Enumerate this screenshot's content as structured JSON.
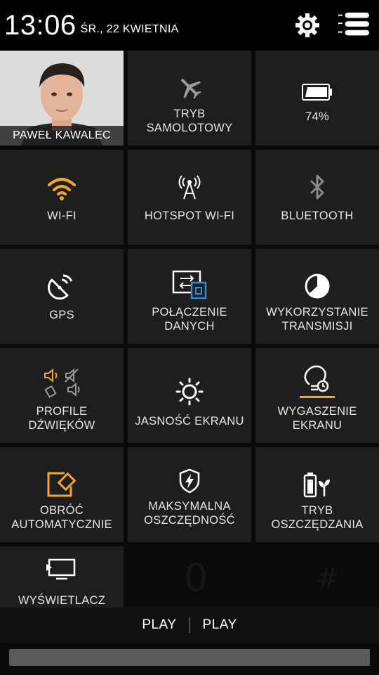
{
  "status_bar": {
    "time": "13:06",
    "date": "ŚR., 22 KWIETNIA"
  },
  "profile": {
    "name": "PAWEŁ KAWALEC"
  },
  "tiles": {
    "airplane": {
      "label": "TRYB SAMOLOTOWY",
      "icon": "airplane-icon"
    },
    "battery": {
      "label": "74%",
      "icon": "battery-icon",
      "level": 0.74
    },
    "wifi": {
      "label": "WI-FI",
      "icon": "wifi-icon",
      "active": true
    },
    "hotspot": {
      "label": "HOTSPOT WI-FI",
      "icon": "hotspot-icon"
    },
    "bluetooth": {
      "label": "BLUETOOTH",
      "icon": "bluetooth-icon"
    },
    "gps": {
      "label": "GPS",
      "icon": "gps-icon"
    },
    "data": {
      "label": "POŁĄCZENIE DANYCH",
      "icon": "data-connection-icon"
    },
    "usage": {
      "label": "WYKORZYSTANIE TRANSMISJI",
      "icon": "data-usage-icon"
    },
    "sound": {
      "label": "PROFILE DŹWIĘKÓW",
      "icon": "sound-profiles-icon"
    },
    "brightness": {
      "label": "JASNOŚĆ EKRANU",
      "icon": "brightness-icon"
    },
    "timeout": {
      "label": "WYGASZENIE EKRANU",
      "icon": "screen-timeout-icon"
    },
    "rotate": {
      "label": "OBRÓĆ AUTOMATYCZNIE",
      "icon": "auto-rotate-icon"
    },
    "max_saving": {
      "label": "MAKSYMALNA OSZCZĘDNOŚĆ",
      "icon": "max-power-saving-icon"
    },
    "saving": {
      "label": "TRYB OSZCZĘDZANIA",
      "icon": "power-saving-icon"
    },
    "display": {
      "label": "WYŚWIETLACZ",
      "icon": "screen-mirror-icon"
    }
  },
  "bottom_bar": {
    "left": "PLAY",
    "right": "PLAY"
  },
  "colors": {
    "accent": "#f5a623",
    "tile_bg": "#1e1e1e",
    "blue": "#2a8fd8"
  }
}
